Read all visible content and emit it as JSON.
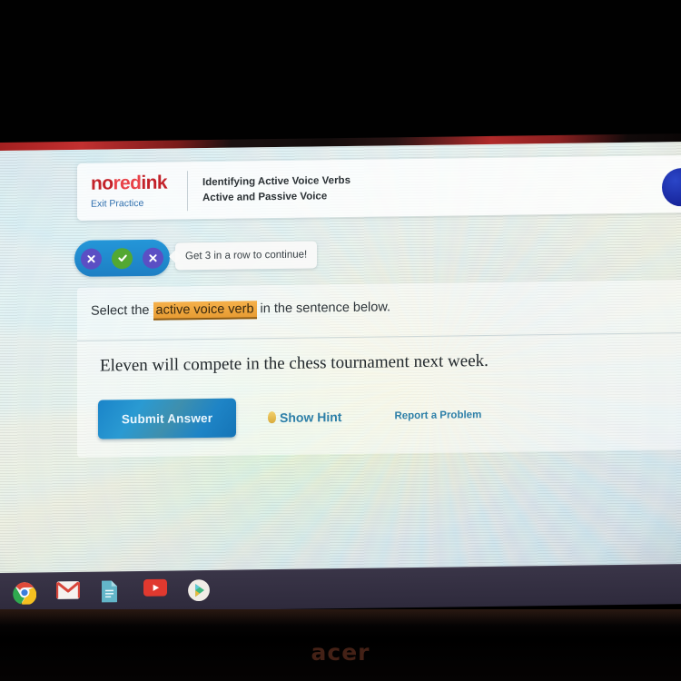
{
  "device": {
    "brand_logo": "acer"
  },
  "browser": {
    "top_strip_visible": true
  },
  "header": {
    "logo": {
      "part1": "no",
      "part2": "red",
      "part3": "ink",
      "color_dark": "#c3222a",
      "color_bright": "#e8434a"
    },
    "exit_link": "Exit Practice",
    "title": "Identifying Active Voice Verbs",
    "subtitle": "Active and Passive Voice",
    "right_button": "account-button"
  },
  "progress": {
    "pips": [
      {
        "state": "wrong",
        "glyph": "✕",
        "color": "#5b4fc4"
      },
      {
        "state": "correct",
        "glyph": "✓",
        "color": "#53a832"
      },
      {
        "state": "wrong",
        "glyph": "✕",
        "color": "#5b4fc4"
      }
    ],
    "tooltip": "Get 3 in a row to continue!",
    "bar_color": "#2496d8"
  },
  "question": {
    "prompt_before": "Select the ",
    "prompt_highlight": "active voice verb",
    "prompt_after": " in the sentence below.",
    "highlight_color": "#e79c33",
    "sentence": "Eleven will compete in the chess tournament next week."
  },
  "actions": {
    "submit_label": "Submit Answer",
    "submit_color": "#1a84c9",
    "hint_label": "Show Hint",
    "hint_icon": "lightbulb-icon",
    "report_label": "Report a Problem",
    "link_color": "#2d7fa8"
  },
  "shelf": {
    "background": "#2e2a3c",
    "icons": [
      {
        "name": "chrome-icon"
      },
      {
        "name": "gmail-icon"
      },
      {
        "name": "google-docs-icon"
      },
      {
        "name": "youtube-icon"
      },
      {
        "name": "play-store-icon"
      }
    ]
  }
}
